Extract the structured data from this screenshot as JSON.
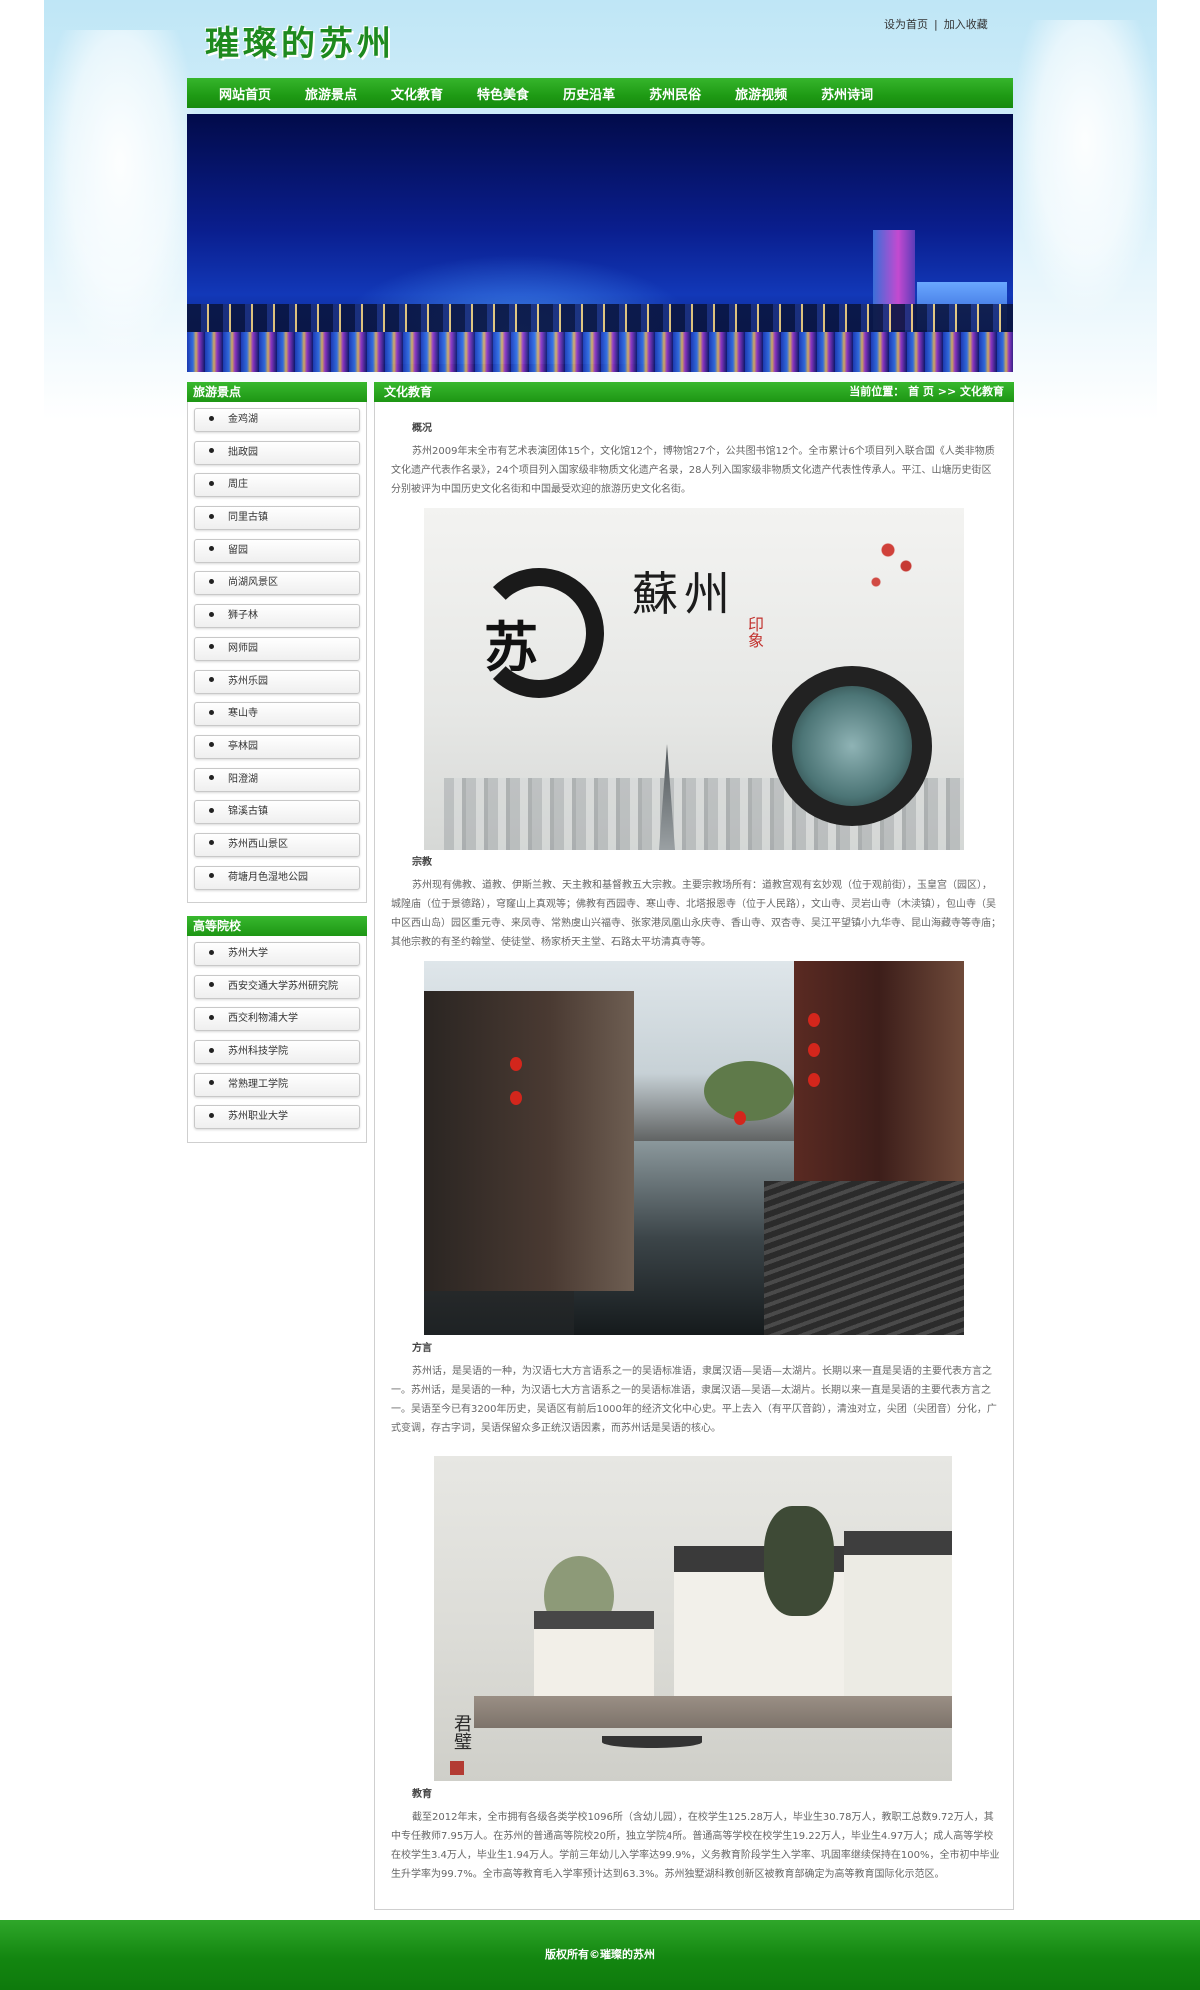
{
  "header": {
    "logo_text": "璀璨的苏州",
    "links": [
      "设为首页",
      "加入收藏"
    ],
    "separator": "|"
  },
  "nav": {
    "items": [
      "网站首页",
      "旅游景点",
      "文化教育",
      "特色美食",
      "历史沿革",
      "苏州民俗",
      "旅游视频",
      "苏州诗词"
    ]
  },
  "sidebar": {
    "scenic": {
      "title": "旅游景点",
      "items": [
        "金鸡湖",
        "拙政园",
        "周庄",
        "同里古镇",
        "留园",
        "尚湖风景区",
        "狮子林",
        "网师园",
        "苏州乐园",
        "寒山寺",
        "亭林园",
        "阳澄湖",
        "锦溪古镇",
        "苏州西山景区",
        "荷塘月色湿地公园"
      ]
    },
    "colleges": {
      "title": "高等院校",
      "items": [
        "苏州大学",
        "西安交通大学苏州研究院",
        "西交利物浦大学",
        "苏州科技学院",
        "常熟理工学院",
        "苏州职业大学"
      ]
    }
  },
  "main": {
    "title": "文化教育",
    "breadcrumb": "当前位置： 首 页 >> 文化教育",
    "sections": [
      {
        "heading": "概况",
        "text": "苏州2009年末全市有艺术表演团体15个，文化馆12个，博物馆27个，公共图书馆12个。全市累计6个项目列入联合国《人类非物质文化遗产代表作名录》，24个项目列入国家级非物质文化遗产名录，28人列入国家级非物质文化遗产代表性传承人。平江、山塘历史街区分别被评为中国历史文化名街和中国最受欢迎的旅游历史文化名街。"
      },
      {
        "heading": "宗教",
        "text": "苏州现有佛教、道教、伊斯兰教、天主教和基督教五大宗教。主要宗教场所有：道教宫观有玄妙观（位于观前街），玉皇宫（园区），城隍庙（位于景德路），穹窿山上真观等；佛教有西园寺、寒山寺、北塔报恩寺（位于人民路），文山寺、灵岩山寺（木渎镇），包山寺（吴中区西山岛）园区重元寺、来凤寺、常熟虞山兴福寺、张家港凤凰山永庆寺、香山寺、双杏寺、吴江平望镇小九华寺、昆山海藏寺等寺庙；其他宗教的有圣约翰堂、使徒堂、杨家桥天主堂、石路太平坊清真寺等。"
      },
      {
        "heading": "方言",
        "text": "苏州话，是吴语的一种，为汉语七大方言语系之一的吴语标准语，隶属汉语—吴语—太湖片。长期以来一直是吴语的主要代表方言之一。苏州话，是吴语的一种，为汉语七大方言语系之一的吴语标准语，隶属汉语—吴语—太湖片。长期以来一直是吴语的主要代表方言之一。吴语至今已有3200年历史，吴语区有前后1000年的经济文化中心史。平上去入（有平仄音韵），清浊对立，尖团（尖团音）分化，广式变调，存古字词，吴语保留众多正统汉语因素，而苏州话是吴语的核心。"
      },
      {
        "heading": "教育",
        "text": "截至2012年末，全市拥有各级各类学校1096所（含幼儿园），在校学生125.28万人，毕业生30.78万人，教职工总数9.72万人，其中专任教师7.95万人。在苏州的普通高等院校20所，独立学院4所。普通高等学校在校学生19.22万人，毕业生4.97万人；成人高等学校在校学生3.4万人，毕业生1.94万人。学前三年幼儿入学率达99.9%，义务教育阶段学生入学率、巩固率继续保持在100%，全市初中毕业生升学率为99.7%。全市高等教育毛入学率预计达到63.3%。苏州独墅湖科教创新区被教育部确定为高等教育国际化示范区。"
      }
    ],
    "image_calligraphy": {
      "big": "苏",
      "title": "蘇州",
      "seal": "印象"
    },
    "image_signature": "君璧"
  },
  "footer": {
    "copyright": "版权所有©璀璨的苏州"
  },
  "colors": {
    "brand_green": "#1e9a14",
    "accent_red": "#c2322e"
  }
}
